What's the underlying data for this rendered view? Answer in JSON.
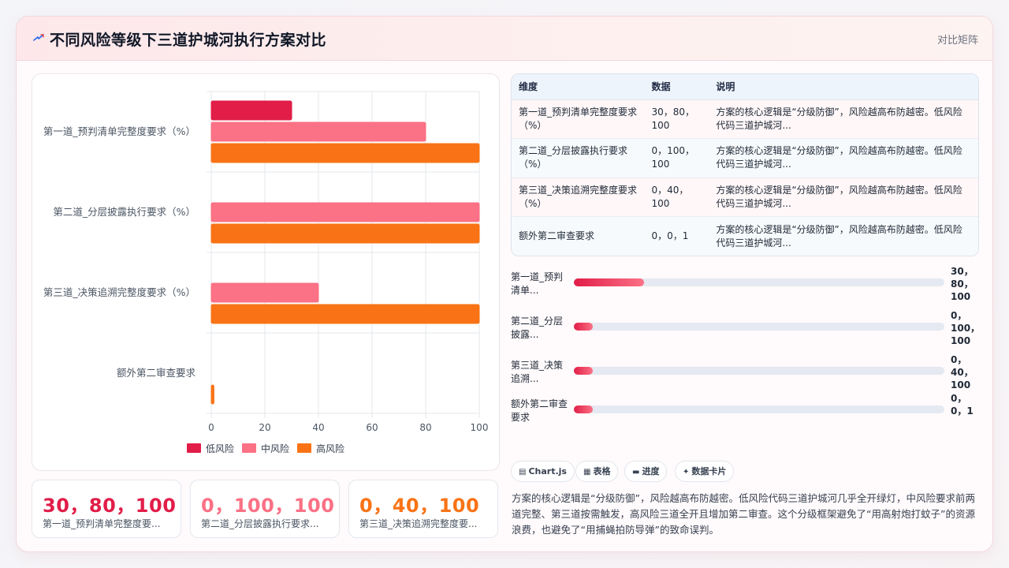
{
  "header": {
    "title": "不同风险等级下三道护城河执行方案对比",
    "matrix_label": "对比矩阵",
    "logo_icon": "lightning-icon"
  },
  "chart_data": {
    "type": "bar",
    "orientation": "horizontal",
    "categories": [
      "第一道_预判清单完整度要求（%）",
      "第二道_分层披露执行要求（%）",
      "第三道_决策追溯完整度要求（%）",
      "额外第二审查要求"
    ],
    "series": [
      {
        "name": "低风险",
        "values": [
          30,
          0,
          0,
          0
        ],
        "color": "#e11d48"
      },
      {
        "name": "中风险",
        "values": [
          80,
          100,
          40,
          0
        ],
        "color": "#fb7185"
      },
      {
        "name": "高风险",
        "values": [
          100,
          100,
          100,
          1
        ],
        "color": "#f97316"
      }
    ],
    "x_ticks": [
      "0",
      "20",
      "40",
      "60",
      "80",
      "100"
    ],
    "xlim": [
      0,
      100
    ],
    "grid": true,
    "legend_position": "bottom"
  },
  "table": {
    "headers": [
      "维度",
      "数据",
      "说明"
    ],
    "rows": [
      {
        "dim": "第一道_预判清单完整度要求（%）",
        "data": "30，80，100",
        "desc": "方案的核心逻辑是“分级防御”，风险越高布防越密。低风险代码三道护城河..."
      },
      {
        "dim": "第二道_分层披露执行要求（%）",
        "data": "0，100，100",
        "desc": "方案的核心逻辑是“分级防御”，风险越高布防越密。低风险代码三道护城河..."
      },
      {
        "dim": "第三道_决策追溯完整度要求（%）",
        "data": "0，40，100",
        "desc": "方案的核心逻辑是“分级防御”，风险越高布防越密。低风险代码三道护城河..."
      },
      {
        "dim": "额外第二审查要求",
        "data": "0，0，1",
        "desc": "方案的核心逻辑是“分级防御”，风险越高布防越密。低风险代码三道护城河..."
      }
    ]
  },
  "progress": [
    {
      "label": "第一道_预判清单...",
      "value": "30，80，100",
      "fraction": 0.19
    },
    {
      "label": "第二道_分层披露...",
      "value": "0，100，100",
      "fraction": 0.05
    },
    {
      "label": "第三道_决策追溯...",
      "value": "0，40，100",
      "fraction": 0.05
    },
    {
      "label": "额外第二审查要求",
      "value": "0，0，1",
      "fraction": 0.05
    }
  ],
  "kpis": [
    {
      "value": "30，80，100",
      "label": "第一道_预判清单完整度要...",
      "color": "#e11d48"
    },
    {
      "value": "0，100，100",
      "label": "第二道_分层披露执行要求...",
      "color": "#fb7185"
    },
    {
      "value": "0，40，100",
      "label": "第三道_决策追溯完整度要...",
      "color": "#f97316"
    }
  ],
  "chips": [
    {
      "icon": "▤",
      "icon_name": "chart-icon",
      "label": "Chart.js"
    },
    {
      "icon": "▦",
      "icon_name": "table-icon",
      "label": "表格"
    },
    {
      "icon": "▬",
      "icon_name": "progress-icon",
      "label": "进度"
    },
    {
      "icon": "✦",
      "icon_name": "sparkle-icon",
      "label": "数据卡片"
    }
  ],
  "summary": "方案的核心逻辑是“分级防御”，风险越高布防越密。低风险代码三道护城河几乎全开绿灯，中风险要求前两道完整、第三道按需触发，高风险三道全开且增加第二审查。这个分级框架避免了“用高射炮打蚊子”的资源浪费，也避免了“用捕蝇拍防导弹”的致命误判。"
}
